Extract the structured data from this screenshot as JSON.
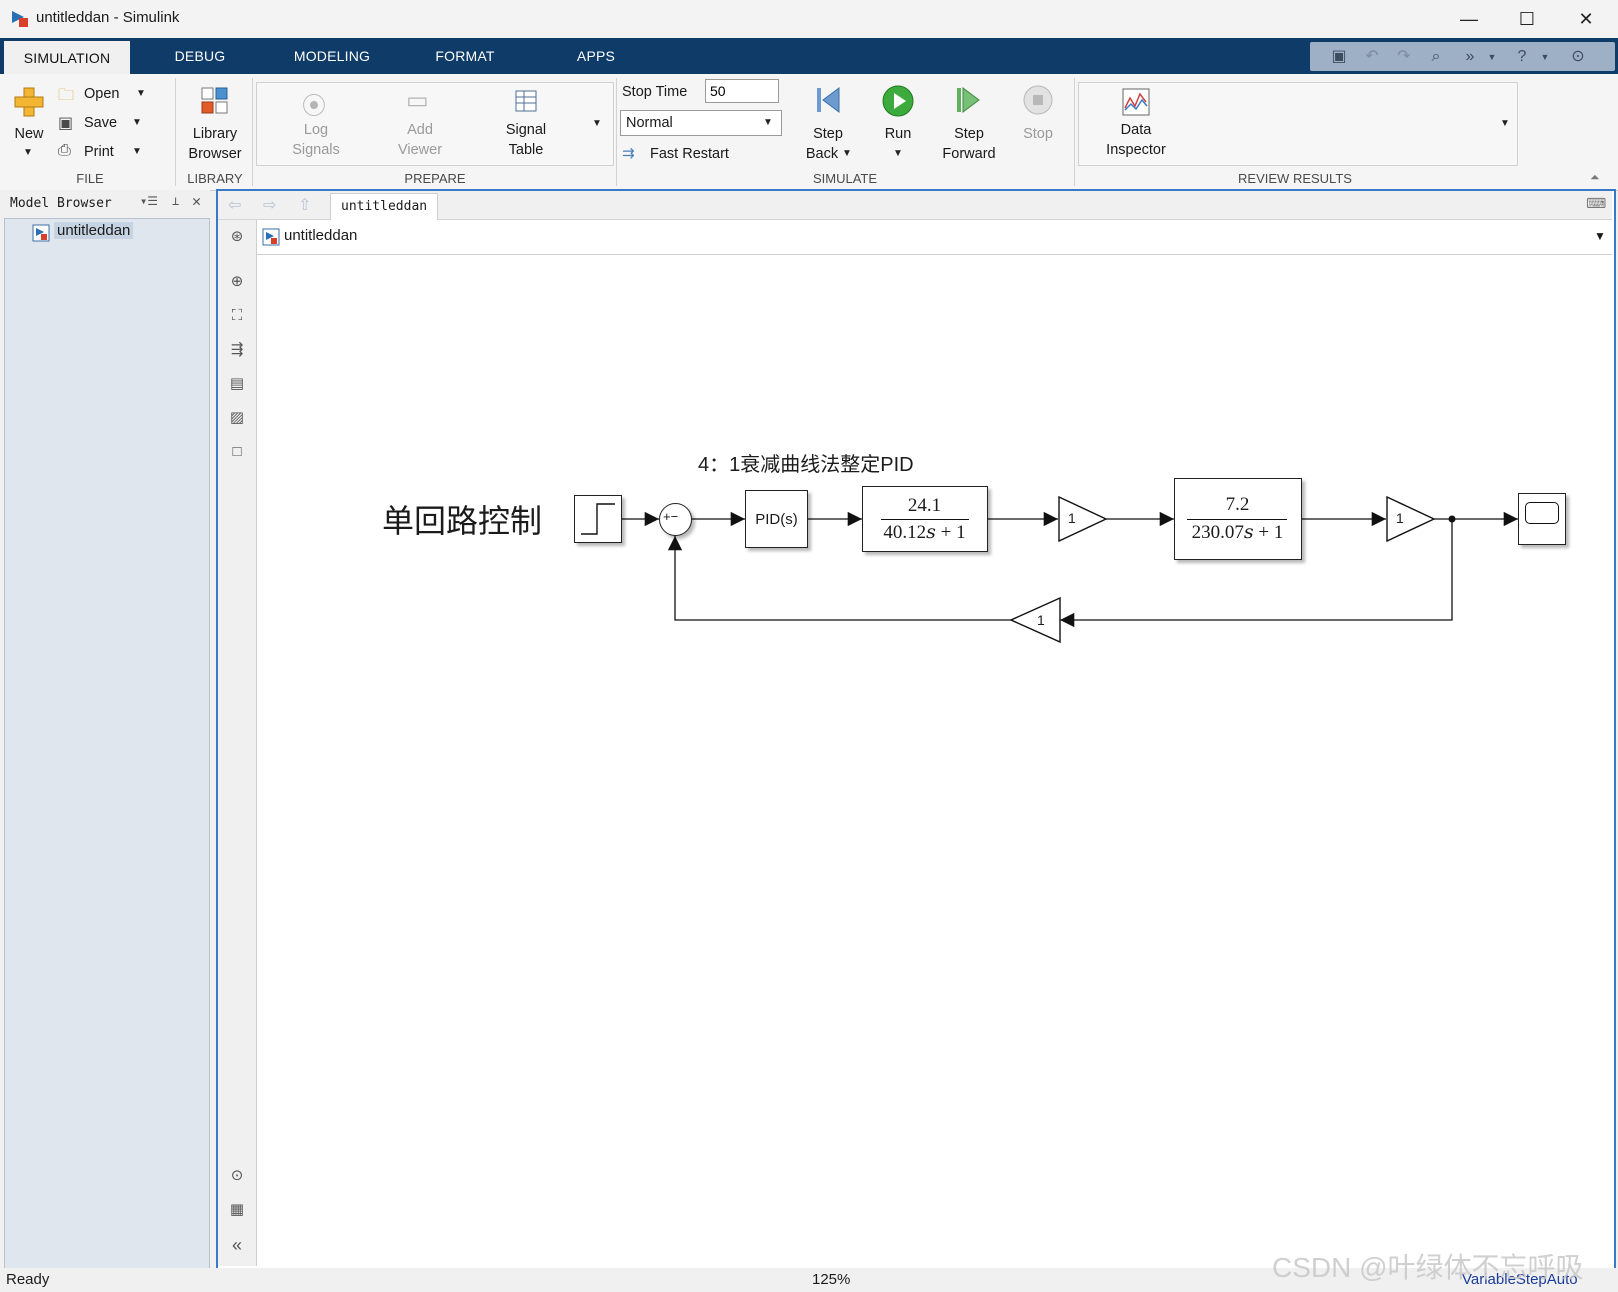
{
  "window": {
    "title": "untitleddan - Simulink",
    "minimize": "—",
    "maximize": "☐",
    "close": "✕"
  },
  "tabs": [
    {
      "label": "SIMULATION",
      "active": true
    },
    {
      "label": "DEBUG"
    },
    {
      "label": "MODELING"
    },
    {
      "label": "FORMAT"
    },
    {
      "label": "APPS"
    }
  ],
  "ribbon": {
    "file": {
      "group_label": "FILE",
      "new_label": "New",
      "open_label": "Open",
      "save_label": "Save",
      "print_label": "Print"
    },
    "library": {
      "group_label": "LIBRARY",
      "browser_line1": "Library",
      "browser_line2": "Browser"
    },
    "prepare": {
      "group_label": "PREPARE",
      "log_line1": "Log",
      "log_line2": "Signals",
      "viewer_line1": "Add",
      "viewer_line2": "Viewer",
      "table_line1": "Signal",
      "table_line2": "Table"
    },
    "simulate": {
      "group_label": "SIMULATE",
      "stop_time_label": "Stop Time",
      "stop_time_value": "50",
      "mode_value": "Normal",
      "fast_restart_label": "Fast Restart",
      "step_back_line1": "Step",
      "step_back_line2": "Back",
      "run_label": "Run",
      "step_fwd_line1": "Step",
      "step_fwd_line2": "Forward",
      "stop_label": "Stop"
    },
    "review": {
      "group_label": "REVIEW RESULTS",
      "inspector_line1": "Data",
      "inspector_line2": "Inspector"
    }
  },
  "model_browser": {
    "title": "Model Browser",
    "item": "untitleddan"
  },
  "editor": {
    "tab_label": "untitleddan",
    "breadcrumb": "untitleddan"
  },
  "diagram": {
    "annotation_title": "4：1衰减曲线法整定PID",
    "annotation_side": "单回路控制",
    "sum_signs": "+−",
    "pid_label": "PID(s)",
    "tf1_num": "24.1",
    "tf1_den": "40.12𝑠 + 1",
    "gain1": "1",
    "tf2_num": "7.2",
    "tf2_den": "230.07𝑠 + 1",
    "gain2": "1",
    "feedback_gain": "1"
  },
  "status": {
    "left": "Ready",
    "zoom": "125%",
    "solver": "VariableStepAuto"
  },
  "watermark": "CSDN @叶绿体不忘呼吸"
}
